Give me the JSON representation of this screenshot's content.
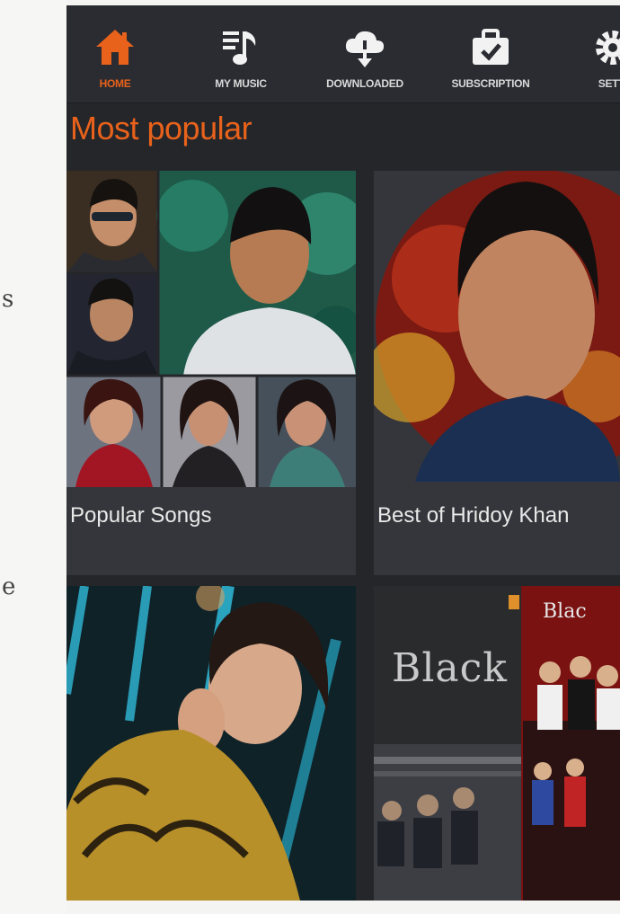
{
  "nav": {
    "items": [
      {
        "label": "HOME",
        "icon": "home-icon",
        "active": true
      },
      {
        "label": "MY MUSIC",
        "icon": "music-list-icon",
        "active": false
      },
      {
        "label": "DOWNLOADED",
        "icon": "cloud-download-icon",
        "active": false
      },
      {
        "label": "SUBSCRIPTION",
        "icon": "briefcase-check-icon",
        "active": false
      },
      {
        "label": "SETTI",
        "icon": "gear-icon",
        "active": false
      }
    ]
  },
  "section": {
    "title": "Most popular"
  },
  "cards": [
    {
      "title": "Popular Songs"
    },
    {
      "title": "Best of Hridoy Khan"
    },
    {
      "title": ""
    },
    {
      "title": ""
    }
  ],
  "album_texts": {
    "black_logo": "Black",
    "black_logo_small": "Blac"
  },
  "side_fragments": {
    "a": "s",
    "b": "e"
  },
  "colors": {
    "accent": "#e8621b",
    "background": "#25262a",
    "card": "#35363b"
  }
}
